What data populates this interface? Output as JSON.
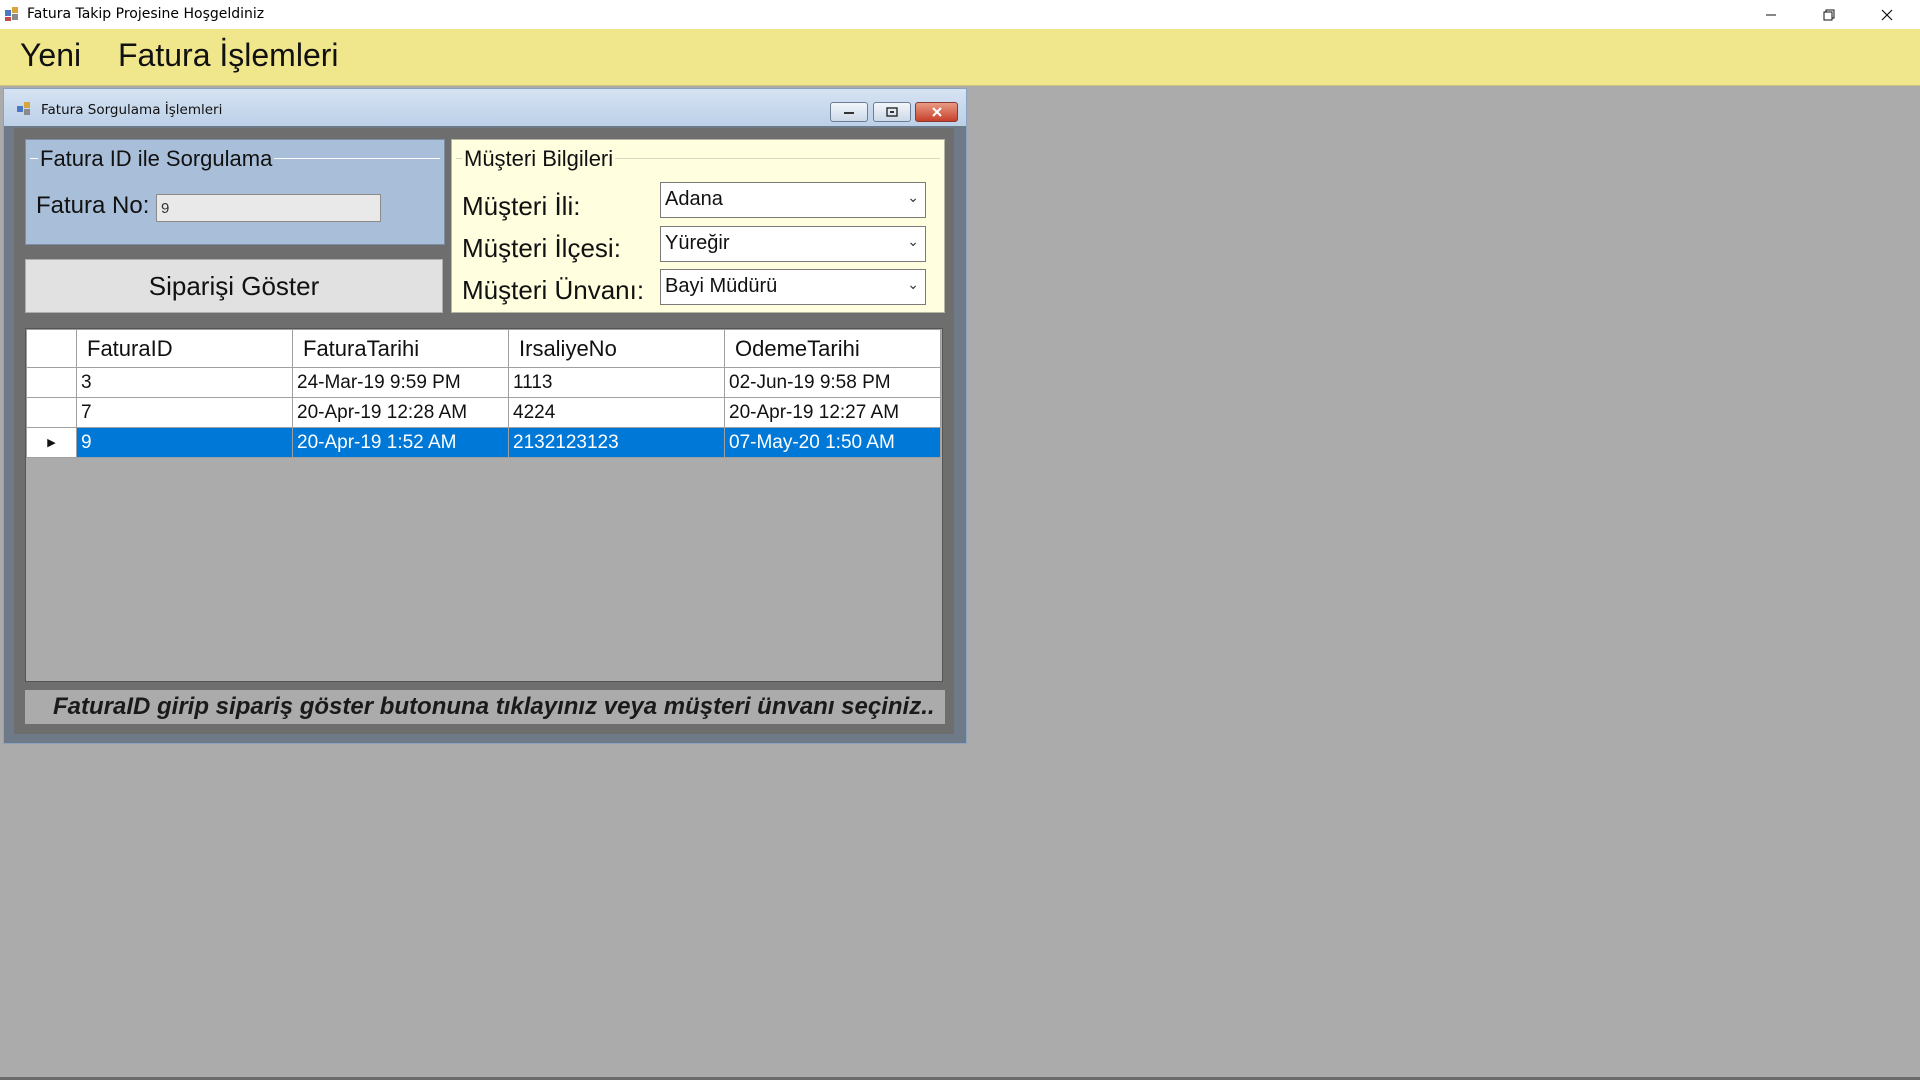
{
  "app": {
    "title": "Fatura Takip Projesine Hoşgeldiniz"
  },
  "menu": {
    "items": [
      "Yeni",
      "Fatura İşlemleri"
    ]
  },
  "child": {
    "title": "Fatura Sorgulama İşlemleri",
    "fatura_group": {
      "title": "Fatura ID ile Sorgulama",
      "fatura_no_label": "Fatura No:",
      "fatura_no_value": "9"
    },
    "show_button": "Siparişi Göster",
    "musteri_group": {
      "title": "Müşteri Bilgileri",
      "il_label": "Müşteri İli:",
      "il_value": "Adana",
      "ilce_label": "Müşteri İlçesi:",
      "ilce_value": "Yüreğir",
      "unvan_label": "Müşteri Ünvanı:",
      "unvan_value": "Bayi Müdürü"
    },
    "grid": {
      "columns": [
        "FaturaID",
        "FaturaTarihi",
        "IrsaliyeNo",
        "OdemeTarihi"
      ],
      "rows": [
        [
          "3",
          "24-Mar-19 9:59 PM",
          "1113",
          "02-Jun-19 9:58 PM"
        ],
        [
          "7",
          "20-Apr-19 12:28 AM",
          "4224",
          "20-Apr-19 12:27 AM"
        ],
        [
          "9",
          "20-Apr-19 1:52 AM",
          "2132123123",
          "07-May-20 1:50 AM"
        ]
      ],
      "selected_row": 2
    },
    "hint": "FaturaID girip sipariş göster butonuna tıklayınız veya müşteri ünvanı seçiniz.."
  },
  "colors": {
    "menubar": "#f0e68c",
    "selection": "#0078d7",
    "musteri_group_bg": "#ffffe0",
    "fatura_group_bg": "#a9bfd9"
  }
}
